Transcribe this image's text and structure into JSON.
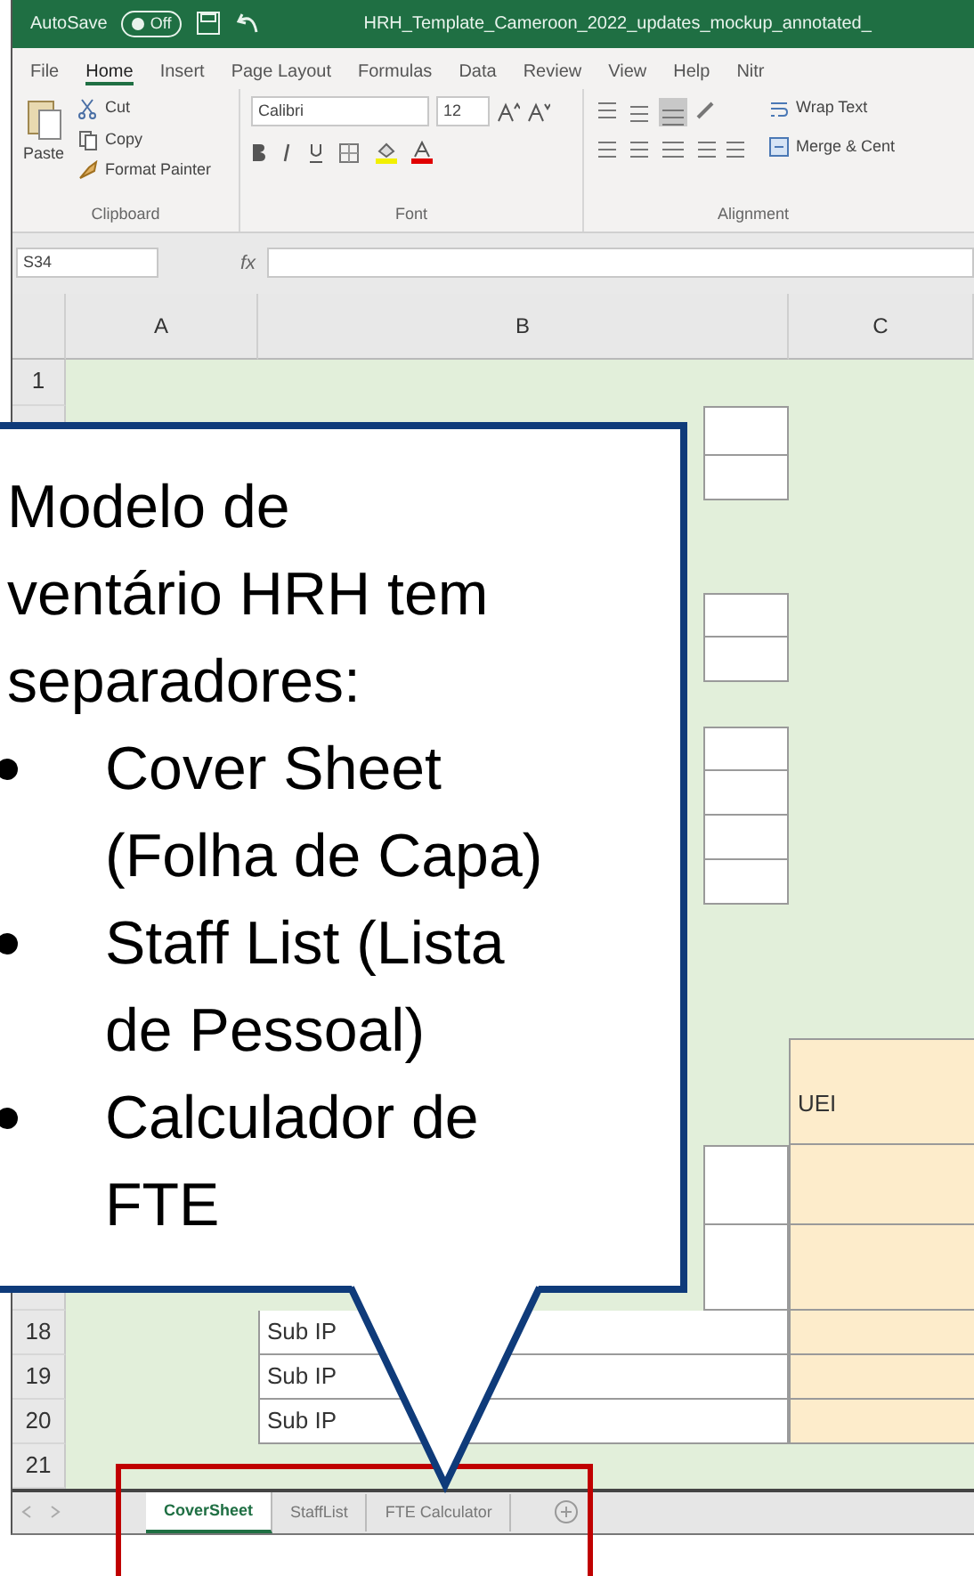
{
  "window": {
    "title": "HRH_Template_Cameroon_2022_updates_mockup_annotated_",
    "autosave_label": "AutoSave",
    "autosave_toggle": "Off"
  },
  "ribbon_tabs": [
    {
      "label": "File",
      "selected": false
    },
    {
      "label": "Home",
      "selected": true
    },
    {
      "label": "Insert",
      "selected": false
    },
    {
      "label": "Page Layout",
      "selected": false
    },
    {
      "label": "Formulas",
      "selected": false
    },
    {
      "label": "Data",
      "selected": false
    },
    {
      "label": "Review",
      "selected": false
    },
    {
      "label": "View",
      "selected": false
    },
    {
      "label": "Help",
      "selected": false
    },
    {
      "label": "Nitr",
      "selected": false
    }
  ],
  "ribbon_groups": [
    {
      "kind": "clipboard",
      "label": "Clipboard",
      "paste": "Paste",
      "items": [
        "Cut",
        "Copy",
        "Format Painter"
      ]
    },
    {
      "kind": "font",
      "label": "Font",
      "font_name": "Calibri",
      "font_size": "12"
    },
    {
      "kind": "alignment",
      "label": "Alignment",
      "items": [
        "Wrap Text",
        "Merge & Cent"
      ]
    }
  ],
  "formula_bar": {
    "name_box": "S34",
    "fx": "fx"
  },
  "sheet": {
    "columns": [
      "A",
      "B",
      "C"
    ],
    "top_rows": [
      "1"
    ],
    "uei_label": "UEI",
    "bottom_rows": [
      {
        "number": "18",
        "b": "Sub IP"
      },
      {
        "number": "19",
        "b": "Sub IP"
      },
      {
        "number": "20",
        "b": "Sub IP"
      },
      {
        "number": "21"
      }
    ]
  },
  "sheet_tabs": [
    {
      "label": "CoverSheet",
      "selected": true
    },
    {
      "label": "StaffList",
      "selected": false
    },
    {
      "label": "FTE Calculator",
      "selected": false
    }
  ],
  "callout": {
    "text": "Modelo de\nventário HRH tem\nseparadores:",
    "bullets": [
      "Cover Sheet\n(Folha de Capa)",
      "Staff List (Lista\nde Pessoal)",
      "Calculador de\nFTE"
    ]
  }
}
